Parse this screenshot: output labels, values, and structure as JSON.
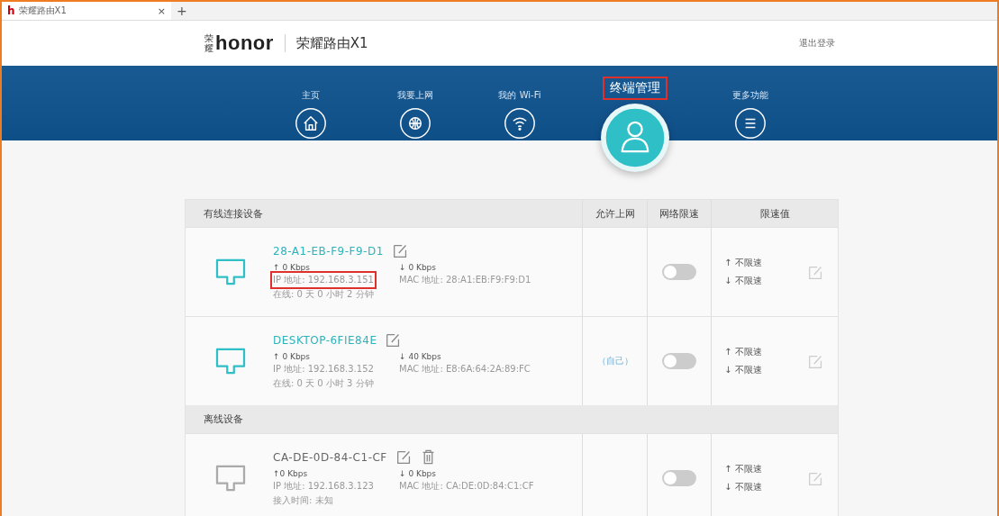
{
  "browser_tab": {
    "favicon": "h",
    "title": "荣耀路由X1",
    "close": "×",
    "new_tab": "+"
  },
  "header": {
    "logo_mark": "荣耀",
    "logo": "honor",
    "title": "荣耀路由X1",
    "logout": "退出登录"
  },
  "nav": [
    {
      "label": "主页",
      "kind": "home",
      "selected": false
    },
    {
      "label": "我要上网",
      "kind": "globe",
      "selected": false
    },
    {
      "label": "我的 Wi-Fi",
      "kind": "wifi",
      "selected": false
    },
    {
      "label": "终端管理",
      "kind": "user",
      "selected": true
    },
    {
      "label": "更多功能",
      "kind": "menu",
      "selected": false
    }
  ],
  "table": {
    "columns": [
      "有线连接设备",
      "允许上网",
      "网络限速",
      "限速值"
    ],
    "sections": [
      {
        "devices": [
          {
            "kind": "online",
            "name": "28-A1-EB-F9-F9-D1",
            "up": "↑ 0 Kbps",
            "down": "↓ 0 Kbps",
            "ip": "IP 地址: 192.168.3.151",
            "ip_highlighted": true,
            "mac": "MAC 地址: 28:A1:EB:F9:F9:D1",
            "time": "在线: 0 天 0 小时 2 分钟",
            "limit_on": false,
            "up_limit": "↑ 不限速",
            "down_limit": "↓ 不限速"
          },
          {
            "kind": "online",
            "name": "DESKTOP-6FIE84E",
            "up": "↑ 0 Kbps",
            "down": "↓ 40 Kbps",
            "ip": "IP 地址: 192.168.3.152",
            "ip_highlighted": false,
            "mac": "MAC 地址: E8:6A:64:2A:89:FC",
            "time": "在线: 0 天 0 小时 3 分钟",
            "allow": "（自己）",
            "limit_on": false,
            "up_limit": "↑ 不限速",
            "down_limit": "↓ 不限速"
          }
        ]
      },
      {
        "title": "离线设备",
        "devices": [
          {
            "kind": "offline",
            "name": "CA-DE-0D-84-C1-CF",
            "up": "↑0 Kbps",
            "down": "↓ 0 Kbps",
            "ip": "IP 地址: 192.168.3.123",
            "ip_highlighted": false,
            "mac": "MAC 地址: CA:DE:0D:84:C1:CF",
            "time": "接入时间: 未知",
            "limit_on": false,
            "up_limit": "↑ 不限速",
            "down_limit": "↓ 不限速"
          }
        ]
      }
    ]
  }
}
